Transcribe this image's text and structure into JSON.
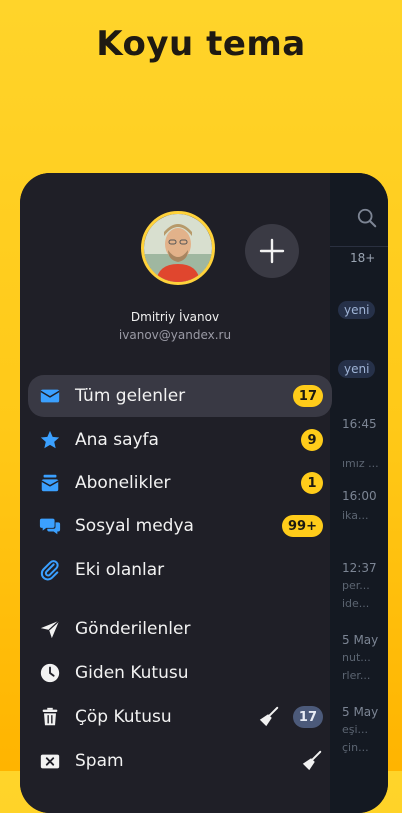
{
  "promo": {
    "title": "Koyu tema"
  },
  "background_list": {
    "counter": "18+",
    "chips": [
      "yeni",
      "yeni"
    ],
    "times": [
      "16:45",
      "16:00",
      "12:37",
      "5 May",
      "5 May"
    ],
    "snippets": [
      "ımız ...",
      "ika...",
      "per...",
      "ide...",
      "nut...",
      "rler...",
      "eşi...",
      "çin..."
    ]
  },
  "account": {
    "name": "Dmitriy İvanov",
    "email": "ivanov@yandex.ru"
  },
  "nav": [
    {
      "label": "Tüm gelenler",
      "icon": "envelope-icon",
      "badge": "17",
      "badge_style": "yellow",
      "active": true
    },
    {
      "label": "Ana sayfa",
      "icon": "star-icon",
      "badge": "9",
      "badge_style": "yellow"
    },
    {
      "label": "Abonelikler",
      "icon": "subscriptions-icon",
      "badge": "1",
      "badge_style": "yellow"
    },
    {
      "label": "Sosyal medya",
      "icon": "chat-bubbles-icon",
      "badge": "99+",
      "badge_style": "yellow"
    },
    {
      "label": "Eki olanlar",
      "icon": "paperclip-icon"
    },
    {
      "label": "Gönderilenler",
      "icon": "send-icon"
    },
    {
      "label": "Giden Kutusu",
      "icon": "clock-icon"
    },
    {
      "label": "Çöp Kutusu",
      "icon": "trash-icon",
      "badge": "17",
      "badge_style": "gray",
      "broom": true
    },
    {
      "label": "Spam",
      "icon": "spam-icon",
      "broom": true
    }
  ],
  "colors": {
    "accent": "#ffcc1a",
    "icon_blue": "#3ba0ff",
    "drawer_bg": "#1f1f27"
  }
}
